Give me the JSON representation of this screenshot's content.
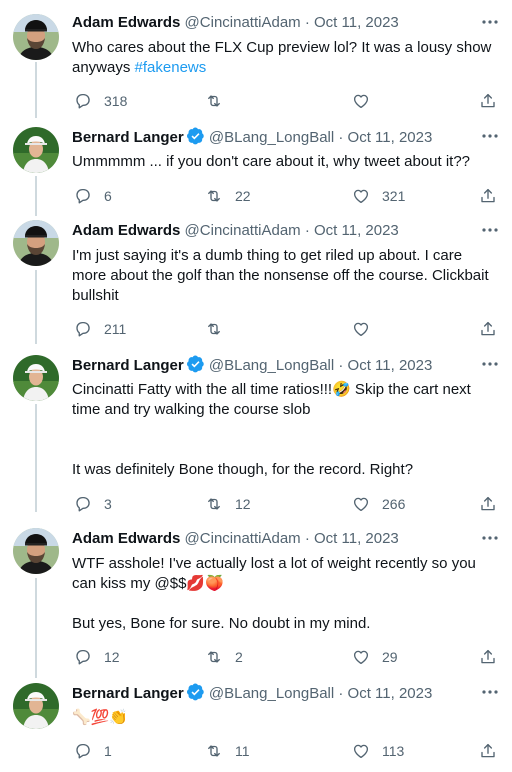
{
  "tweets": [
    {
      "name": "Adam Edwards",
      "handle": "@CincinattiAdam",
      "sep": "·",
      "date": "Oct 11, 2023",
      "text": "Who cares about the FLX Cup preview lol? It was a lousy show anyways ",
      "hashtag": "#fakenews",
      "replies": "318",
      "retweets": "",
      "likes": ""
    },
    {
      "name": "Bernard Langer",
      "handle": "@BLang_LongBall",
      "sep": "·",
      "date": "Oct 11, 2023",
      "text": "Ummmmm ... if you don't care about it, why tweet about it??",
      "replies": "6",
      "retweets": "22",
      "likes": "321"
    },
    {
      "name": "Adam Edwards",
      "handle": "@CincinattiAdam",
      "sep": "·",
      "date": "Oct 11, 2023",
      "text": "I'm just saying it's a dumb thing to get riled up about. I care more about the golf than the nonsense off the course. Clickbait bullshit",
      "replies": "211",
      "retweets": "",
      "likes": ""
    },
    {
      "name": "Bernard Langer",
      "handle": "@BLang_LongBall",
      "sep": "·",
      "date": "Oct 11, 2023",
      "text": "Cincinatti Fatty with the all time ratios!!!🤣 Skip the cart next time and try walking the course slob\n\n\nIt was definitely Bone though, for the record. Right?",
      "replies": "3",
      "retweets": "12",
      "likes": "266"
    },
    {
      "name": "Adam Edwards",
      "handle": "@CincinattiAdam",
      "sep": "·",
      "date": "Oct 11, 2023",
      "text": "WTF asshole! I've actually lost a lot of weight recently so you can kiss my @$$💋🍑\n\nBut yes, Bone for sure. No doubt in my mind.",
      "replies": "12",
      "retweets": "2",
      "likes": "29"
    },
    {
      "name": "Bernard Langer",
      "handle": "@BLang_LongBall",
      "sep": "·",
      "date": "Oct 11, 2023",
      "text": "🦴💯👏",
      "replies": "1",
      "retweets": "11",
      "likes": "113"
    }
  ],
  "colors": {
    "accent": "#1d9bf0",
    "muted": "#536471",
    "text": "#0f1419"
  }
}
